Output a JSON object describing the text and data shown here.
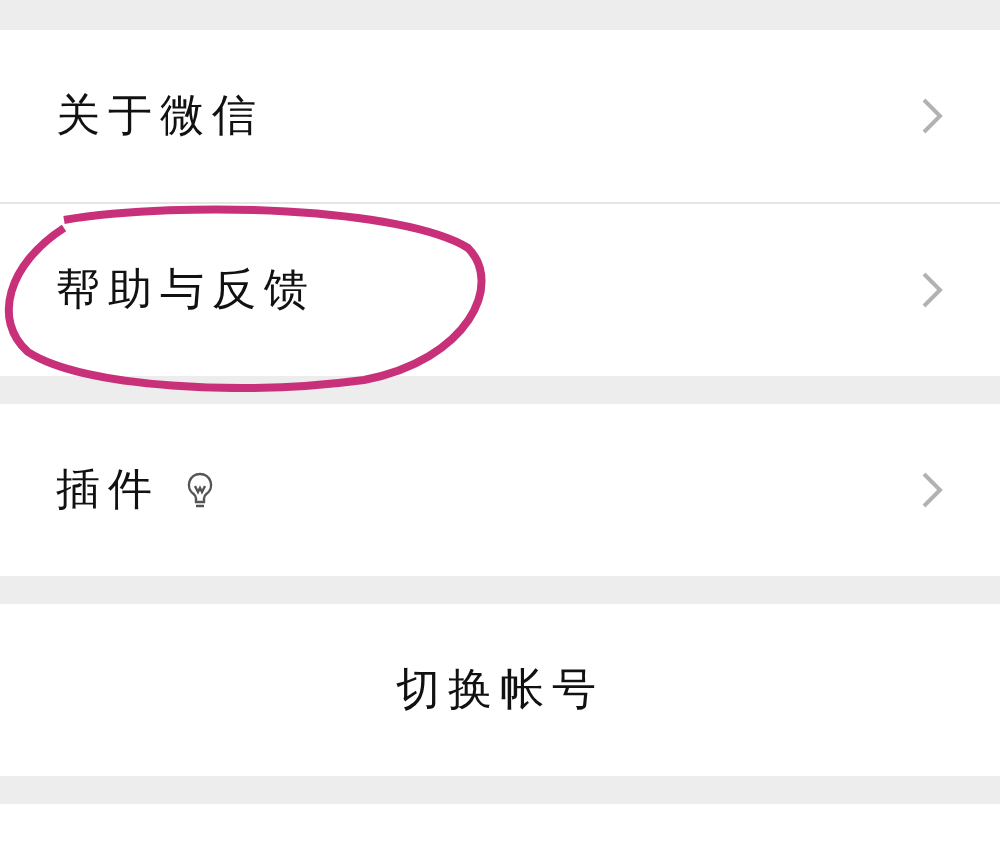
{
  "groups": [
    {
      "items": [
        {
          "kind": "link",
          "label": "关于微信",
          "circled": false
        },
        {
          "kind": "link",
          "label": "帮助与反馈",
          "circled": true
        }
      ]
    },
    {
      "items": [
        {
          "kind": "link_bulb",
          "label": "插件",
          "circled": false
        }
      ]
    },
    {
      "items": [
        {
          "kind": "action",
          "label": "切换帐号",
          "circled": false
        }
      ]
    }
  ]
}
